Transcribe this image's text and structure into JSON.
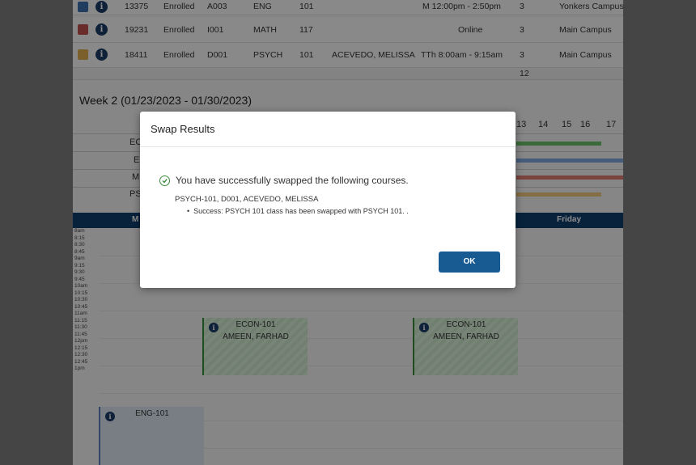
{
  "enrollments": [
    {
      "color": "#3c6fb0",
      "crn": "13375",
      "status": "Enrolled",
      "section": "A003",
      "subject": "ENG",
      "course": "101",
      "instructor": "",
      "time": "M 12:00pm - 2:50pm",
      "credits": "3",
      "campus": "Yonkers Campus"
    },
    {
      "color": "#c0504d",
      "crn": "19231",
      "status": "Enrolled",
      "section": "I001",
      "subject": "MATH",
      "course": "117",
      "instructor": "",
      "time": "Online",
      "credits": "3",
      "campus": "Main Campus"
    },
    {
      "color": "#e0b050",
      "crn": "18411",
      "status": "Enrolled",
      "section": "D001",
      "subject": "PSYCH",
      "course": "101",
      "instructor": "ACEVEDO, MELISSA",
      "time": "TTh 8:00am - 9:15am",
      "credits": "3",
      "campus": "Main Campus"
    }
  ],
  "total_credits": "12",
  "week_title": "Week 2 (01/23/2023 - 01/30/2023)",
  "gantt_labels": [
    "EC",
    "E",
    "M",
    "PS"
  ],
  "gantt_days": [
    "13",
    "14",
    "15",
    "16",
    "17"
  ],
  "schedule": {
    "days": [
      "M",
      "Friday"
    ],
    "times": [
      "8am",
      "8:15",
      "8:30",
      "8:45",
      "9am",
      "9:15",
      "9:30",
      "9:45",
      "10am",
      "10:15",
      "10:30",
      "10:45",
      "11am",
      "11:15",
      "11:30",
      "11:45",
      "12pm",
      "12:15",
      "12:30",
      "12:45",
      "1pm"
    ],
    "blocks": [
      {
        "course": "ECON-101",
        "instructor": "AMEEN, FARHAD"
      },
      {
        "course": "ECON-101",
        "instructor": "AMEEN, FARHAD"
      },
      {
        "course": "ENG-101",
        "instructor": ""
      }
    ]
  },
  "modal": {
    "title": "Swap Results",
    "message": "You have successfully swapped the following courses.",
    "detail": "PSYCH-101, D001, ACEVEDO, MELISSA",
    "bullet": "Success: PSYCH 101 class has been swapped with PSYCH 101. .",
    "ok_label": "OK"
  },
  "colors": {
    "header": "#0f3e6e",
    "button": "#185a92",
    "success": "#3a8a3a"
  },
  "icons": {
    "info": "info-icon",
    "success": "check-circle-icon"
  }
}
